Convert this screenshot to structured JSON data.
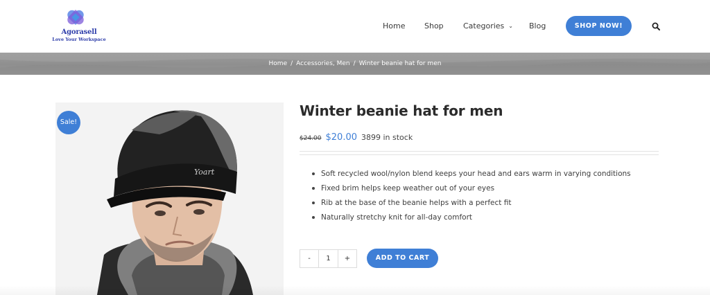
{
  "brand": {
    "name": "Agorasell",
    "tagline": "Love Your Workspace",
    "logo_colors": [
      "#4a7fe0",
      "#3aa0e8",
      "#7a5bd6"
    ]
  },
  "nav": {
    "items": [
      {
        "label": "Home"
      },
      {
        "label": "Shop"
      },
      {
        "label": "Categories",
        "icon": "chevron-down-icon"
      },
      {
        "label": "Blog"
      }
    ],
    "cta_label": "SHOP NOW!",
    "search_icon": "search-icon"
  },
  "breadcrumb": {
    "items": [
      "Home",
      "Accessories, Men",
      "Winter beanie hat for men"
    ],
    "separator": "/"
  },
  "product": {
    "sale_badge": "Sale!",
    "title": "Winter beanie hat for men",
    "price_old": "$24.00",
    "price_new": "$20.00",
    "stock": "3899 in stock",
    "features": [
      "Soft recycled wool/nylon blend keeps your head and ears warm in varying conditions",
      "Fixed brim helps keep weather out of your eyes",
      "Rib at the base of the beanie helps with a perfect fit",
      "Naturally stretchy knit for all-day comfort"
    ],
    "image_logo_text": "Yoart"
  },
  "cart": {
    "minus_label": "-",
    "quantity": "1",
    "plus_label": "+",
    "add_label": "ADD TO CART"
  },
  "colors": {
    "accent": "#3f7fd6",
    "breadcrumb_bg": "#959595"
  }
}
